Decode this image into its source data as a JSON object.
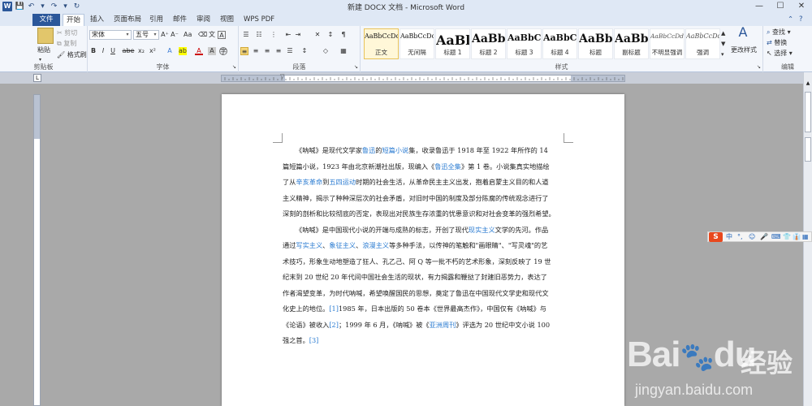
{
  "window": {
    "title": "新建 DOCX 文档 - Microsoft Word",
    "app_icon": "W",
    "controls": [
      "—",
      "☐",
      "✕"
    ]
  },
  "tabs": [
    {
      "label": "文件"
    },
    {
      "label": "开始"
    },
    {
      "label": "插入"
    },
    {
      "label": "页面布局"
    },
    {
      "label": "引用"
    },
    {
      "label": "邮件"
    },
    {
      "label": "审阅"
    },
    {
      "label": "视图"
    },
    {
      "label": "WPS PDF"
    }
  ],
  "clipboard": {
    "paste_label": "粘贴",
    "cut_label": "剪切",
    "copy_label": "复制",
    "format_painter_label": "格式刷",
    "group_label": "剪贴板"
  },
  "font": {
    "font_name": "宋体",
    "font_size": "五号",
    "group_label": "字体",
    "bold": "B",
    "italic": "I",
    "underline": "U",
    "strike": "abe",
    "sub": "x₂",
    "sup": "x²",
    "font_color": "A"
  },
  "paragraph": {
    "group_label": "段落"
  },
  "styles": {
    "group_label": "样式",
    "items": [
      {
        "preview": "AaBbCcDd",
        "name": "正文",
        "selected": true
      },
      {
        "preview": "AaBbCcDd",
        "name": "无间隔"
      },
      {
        "preview": "AaBl",
        "name": "标题 1"
      },
      {
        "preview": "AaBb(",
        "name": "标题 2"
      },
      {
        "preview": "AaBbC",
        "name": "标题 3"
      },
      {
        "preview": "AaBbC(",
        "name": "标题 4"
      },
      {
        "preview": "AaBb(",
        "name": "标题"
      },
      {
        "preview": "AaBb(",
        "name": "副标题"
      },
      {
        "preview": "AaBbCcDd",
        "name": "不明显强调"
      },
      {
        "preview": "AaBbCcDd",
        "name": "强调"
      }
    ],
    "change_styles_label": "更改样式"
  },
  "editing": {
    "group_label": "编辑",
    "find_label": "查找",
    "replace_label": "替换",
    "select_label": "选择"
  },
  "document": {
    "lines": [
      [
        {
          "t": "《呐喊》是现代文学家"
        },
        {
          "t": "鲁迅",
          "l": true
        },
        {
          "t": "的"
        },
        {
          "t": "短篇小说",
          "l": true
        },
        {
          "t": "集，收录鲁迅于 1918 年至 1922 年所作的 14"
        }
      ],
      [
        {
          "t": "篇短篇小说，1923 年由北京新潮社出版，现编入《"
        },
        {
          "t": "鲁迅全集",
          "l": true
        },
        {
          "t": "》第 1 卷。小说集真实地描绘"
        }
      ],
      [
        {
          "t": "了从"
        },
        {
          "t": "辛亥革命",
          "l": true
        },
        {
          "t": "到"
        },
        {
          "t": "五四运动",
          "l": true
        },
        {
          "t": "时期的社会生活，从革命民主主义出发，抱着启蒙主义目的和人道"
        }
      ],
      [
        {
          "t": "主义精神，揭示了种种深层次的社会矛盾，对旧时中国的制度及部分陈腐的传统观念进行了"
        }
      ],
      [
        {
          "t": "深刻的剖析和比较彻底的否定，表现出对民族生存浓重的忧患意识和对社会变革的强烈希望。"
        }
      ],
      [
        {
          "t": "《呐喊》是中国现代小说的开端与成熟的标志，开创了现代"
        },
        {
          "t": "现实主义",
          "l": true
        },
        {
          "t": "文学的先河。作品"
        }
      ],
      [
        {
          "t": "通过"
        },
        {
          "t": "写实主义",
          "l": true
        },
        {
          "t": "、"
        },
        {
          "t": "象征主义",
          "l": true
        },
        {
          "t": "、"
        },
        {
          "t": "浪漫主义",
          "l": true
        },
        {
          "t": "等多种手法，以传神的笔触和\"画眼睛\"、\"写灵魂\"的艺"
        }
      ],
      [
        {
          "t": "术技巧，形象生动地塑造了狂人、孔乙己、阿 Q 等一批不朽的艺术形象，深刻反映了 19 世"
        }
      ],
      [
        {
          "t": "纪末到 20 世纪 20 年代间中国社会生活的现状，有力揭露和鞭挞了封建旧恶势力，表达了"
        }
      ],
      [
        {
          "t": "作者渴望变革，为时代呐喊，希望唤醒国民的思想，奠定了鲁迅在中国现代文学史和现代文"
        }
      ],
      [
        {
          "t": "化史上的地位。"
        },
        {
          "t": "[1]",
          "l": true
        },
        {
          "t": "1985 年，日本出版的 50 卷本《世界最高杰作》，中国仅有《呐喊》与"
        }
      ],
      [
        {
          "t": "《论语》被收入"
        },
        {
          "t": "[2]",
          "l": true
        },
        {
          "t": "；1999 年 6 月，《呐喊》被《"
        },
        {
          "t": "亚洲周刊",
          "l": true
        },
        {
          "t": "》评选为 20 世纪中文小说 100"
        }
      ],
      [
        {
          "t": "强之首。"
        },
        {
          "t": "[3]",
          "l": true
        }
      ]
    ]
  },
  "ime_bar": {
    "logo": "S",
    "items": [
      "中",
      "°,",
      "☺",
      "🎤",
      "⌨",
      "👕",
      "👔",
      "▦"
    ]
  },
  "watermark": {
    "brand": "Bai",
    "brand2": "du",
    "brand_cn": "经验",
    "url": "jingyan.baidu.com"
  }
}
